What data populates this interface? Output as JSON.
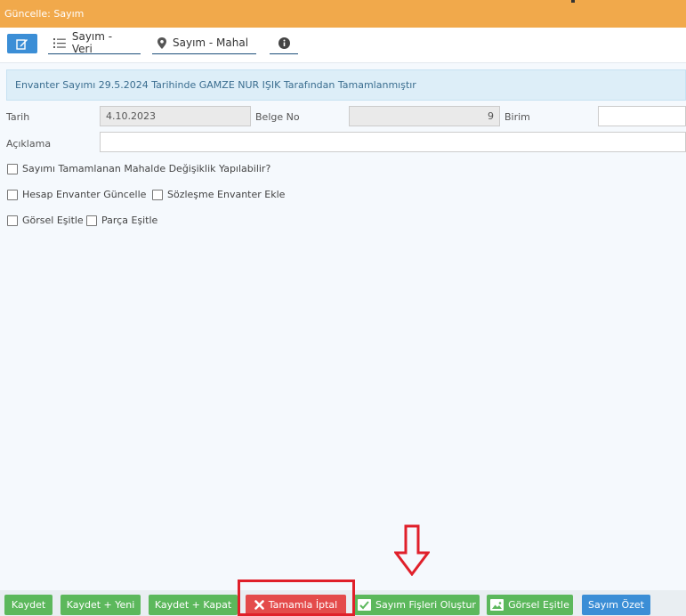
{
  "window": {
    "title": "Güncelle: Sayım"
  },
  "toolbar": {
    "tabs": [
      {
        "label": "Sayım - Veri",
        "icon": "list-icon"
      },
      {
        "label": "Sayım - Mahal",
        "icon": "map-pin-icon"
      },
      {
        "label": "",
        "icon": "info-icon"
      }
    ]
  },
  "alert": {
    "text": "Envanter Sayımı 29.5.2024 Tarihinde GAMZE NUR IŞIK Tarafından Tamamlanmıştır"
  },
  "form": {
    "tarih_label": "Tarih",
    "tarih_value": "4.10.2023",
    "belge_no_label": "Belge No",
    "belge_no_value": "9",
    "birim_label": "Birim",
    "birim_value": "",
    "aciklama_label": "Açıklama",
    "aciklama_value": ""
  },
  "checkboxes": {
    "mahal_degisiklik": "Sayımı Tamamlanan Mahalde Değişiklik Yapılabilir?",
    "hesap_envanter": "Hesap Envanter Güncelle",
    "sozlesme_envanter": "Sözleşme Envanter Ekle",
    "gorsel_esitle": "Görsel Eşitle",
    "parca_esitle": "Parça Eşitle"
  },
  "footer": {
    "kaydet": "Kaydet",
    "kaydet_yeni": "Kaydet + Yeni",
    "kaydet_kapat": "Kaydet + Kapat",
    "tamamla_iptal": "Tamamla İptal",
    "sayim_fisleri": "Sayım Fişleri Oluştur",
    "gorsel_esitle": "Görsel Eşitle",
    "sayim_ozet": "Sayım Özet"
  },
  "colors": {
    "titlebar": "#f1a94b",
    "primary": "#3b8ed6",
    "success": "#5cb85c",
    "danger": "#e44b4b",
    "highlight": "#e0202a"
  }
}
